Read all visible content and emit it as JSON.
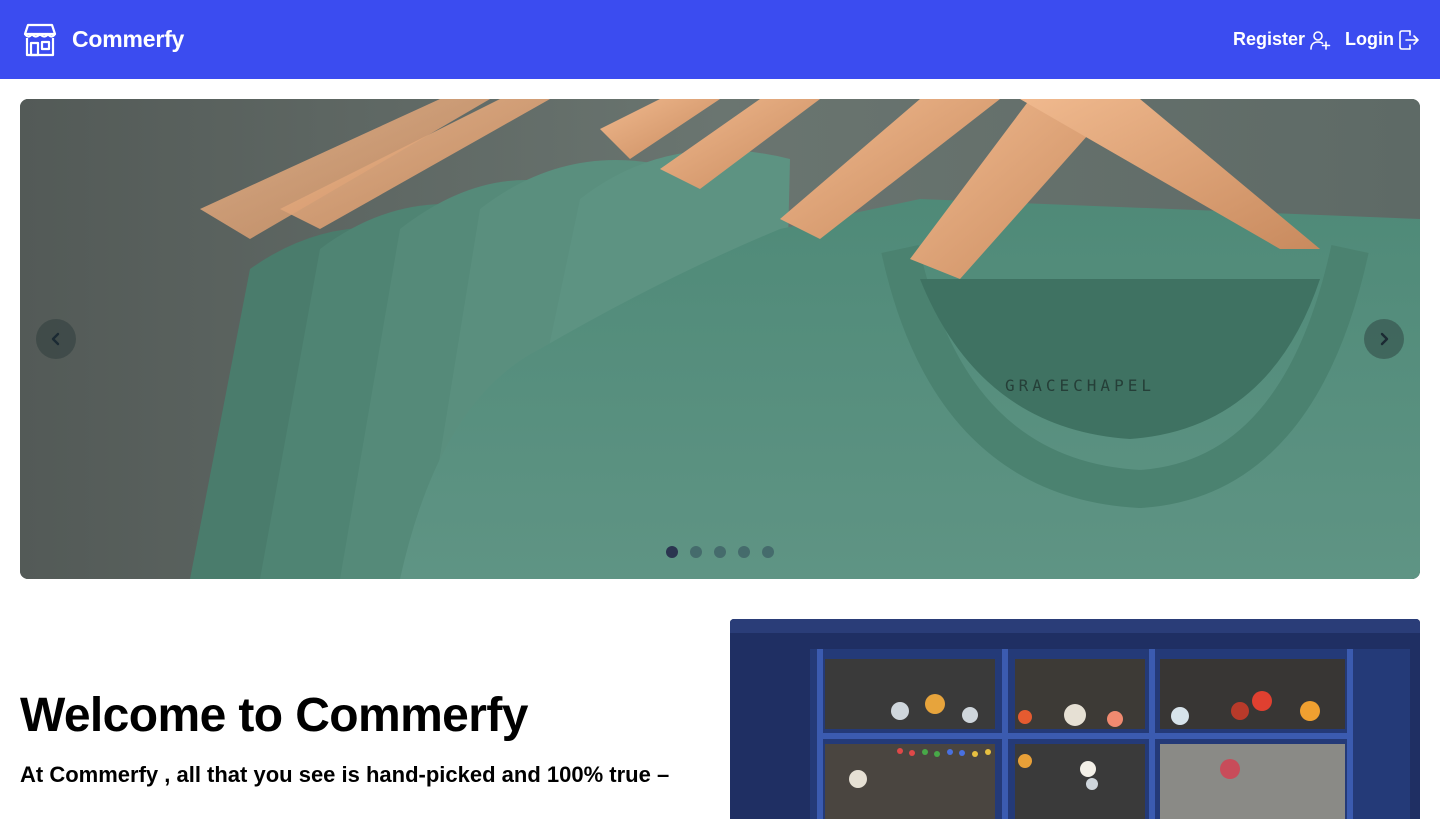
{
  "brand": {
    "name": "Commerfy",
    "icon": "storefront-icon"
  },
  "nav": {
    "register_label": "Register",
    "register_icon": "user-plus-icon",
    "login_label": "Login",
    "login_icon": "login-arrow-icon"
  },
  "carousel": {
    "prev_icon": "chevron-left-icon",
    "next_icon": "chevron-right-icon",
    "slide_count": 5,
    "active_slide": 1,
    "image_label": "GRACECHAPEL"
  },
  "welcome": {
    "title": "Welcome to Commerfy",
    "text": "At Commerfy , all that you see is hand-picked and 100% true –"
  },
  "colors": {
    "navbar": "#3b4cf0",
    "text": "#000000",
    "background": "#ffffff"
  }
}
